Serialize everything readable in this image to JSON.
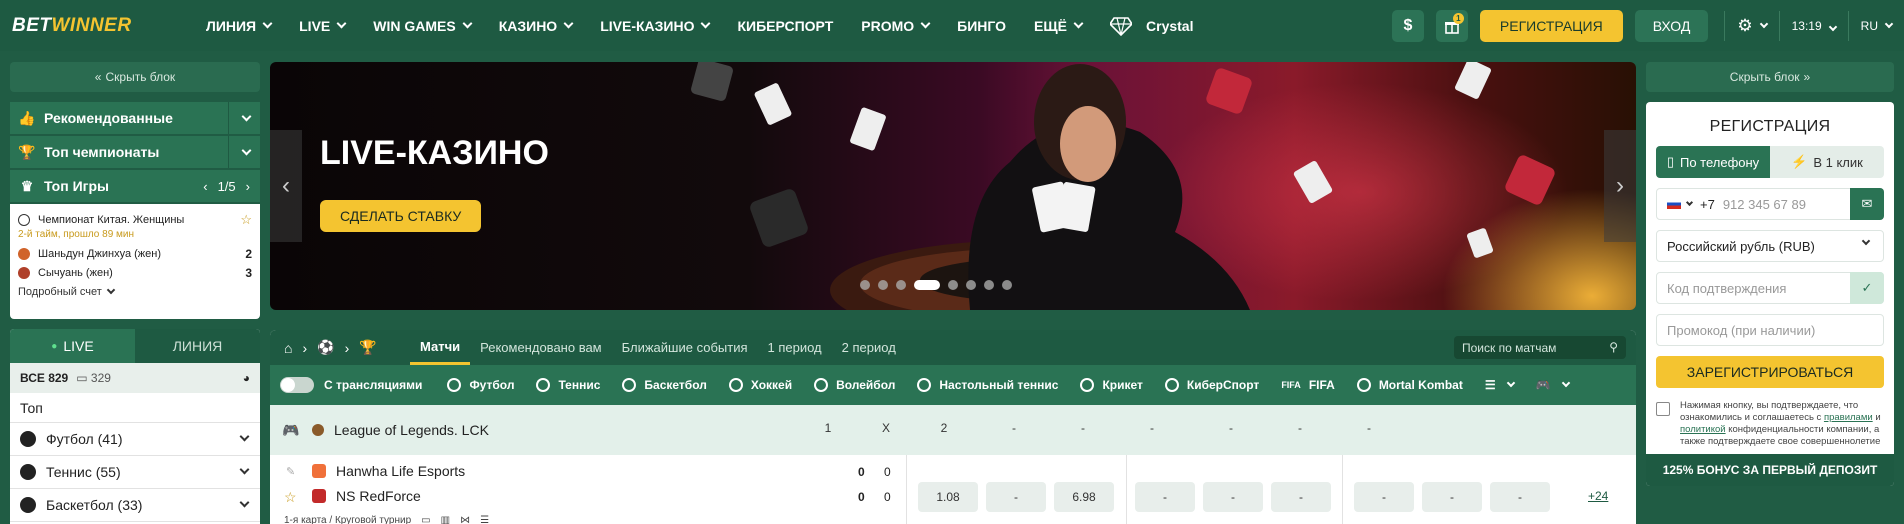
{
  "brand": {
    "part1": "BET",
    "part2": "WINNER"
  },
  "nav": [
    "ЛИНИЯ",
    "LIVE",
    "WIN GAMES",
    "КАЗИНО",
    "LIVE-КАЗИНО",
    "КИБЕРСПОРТ",
    "PROMO",
    "БИНГО",
    "ЕЩЁ",
    "Crystal"
  ],
  "header": {
    "dollar": "$",
    "gift_badge": "1",
    "register": "РЕГИСТРАЦИЯ",
    "login": "ВХОД",
    "time": "13:19",
    "lang": "RU"
  },
  "left": {
    "hide": "Скрыть блок",
    "recommended": "Рекомендованные",
    "top_champ": "Топ чемпионаты",
    "top_games": "Топ Игры",
    "pager": "1/5",
    "game": {
      "league": "Чемпионат Китая. Женщины",
      "status": "2-й тайм, прошло 89 мин",
      "team1": "Шаньдун Джинхуа (жен)",
      "score1": "2",
      "team2": "Сычуань (жен)",
      "score2": "3",
      "detail": "Подробный счет"
    },
    "live_tab": "LIVE",
    "line_tab": "ЛИНИЯ",
    "all": "ВСЕ 829",
    "all_count": "329",
    "top": "Топ",
    "sports": [
      "Футбол (41)",
      "Теннис (55)",
      "Баскетбол (33)"
    ]
  },
  "banner": {
    "title": "LIVE-КАЗИНО",
    "button": "СДЕЛАТЬ СТАВКУ",
    "slides": 8,
    "active_slide": 4
  },
  "events": {
    "tabs": [
      "Матчи",
      "Рекомендовано вам",
      "Ближайшие события",
      "1 период",
      "2 период"
    ],
    "search": "Поиск по матчам",
    "stream_toggle": "С трансляциями",
    "sports": [
      "Футбол",
      "Теннис",
      "Баскетбол",
      "Хоккей",
      "Волейбол",
      "Настольный теннис",
      "Крикет",
      "КиберСпорт",
      "FIFA",
      "Mortal Kombat"
    ],
    "league": "League of Legends. LCK",
    "cols": [
      "1",
      "X",
      "2",
      "-",
      "-",
      "-",
      "-",
      "-",
      "-"
    ],
    "team1": "Hanwha Life Esports",
    "team2": "NS RedForce",
    "s1a": "0",
    "s1b": "0",
    "s2a": "0",
    "s2b": "0",
    "odds": [
      "1.08",
      "-",
      "6.98",
      "-",
      "-",
      "-",
      "-",
      "-",
      "-"
    ],
    "more": "+24",
    "info": "1-я карта / Круговой турнир"
  },
  "right": {
    "hide": "Скрыть блок",
    "title": "РЕГИСТРАЦИЯ",
    "tab_phone": "По телефону",
    "tab_click": "В 1 клик",
    "code": "+7",
    "phone_ph": "912 345 67 89",
    "currency": "Российский рубль (RUB)",
    "confirm_ph": "Код подтверждения",
    "promo_ph": "Промокод (при наличии)",
    "submit": "ЗАРЕГИСТРИРОВАТЬСЯ",
    "agree1": "Нажимая кнопку, вы подтверждаете, что ознакомились и соглашаетесь с",
    "rules": "правилами",
    "and": "и",
    "policy": "политикой",
    "agree2": "конфиденциальности компании, а также подтверждаете свое совершеннолетие",
    "bonus": "125% БОНУС ЗА ПЕРВЫЙ ДЕПОЗИТ"
  },
  "colors": {
    "brand_green": "#1e5a42",
    "accent_yellow": "#f4c430"
  }
}
